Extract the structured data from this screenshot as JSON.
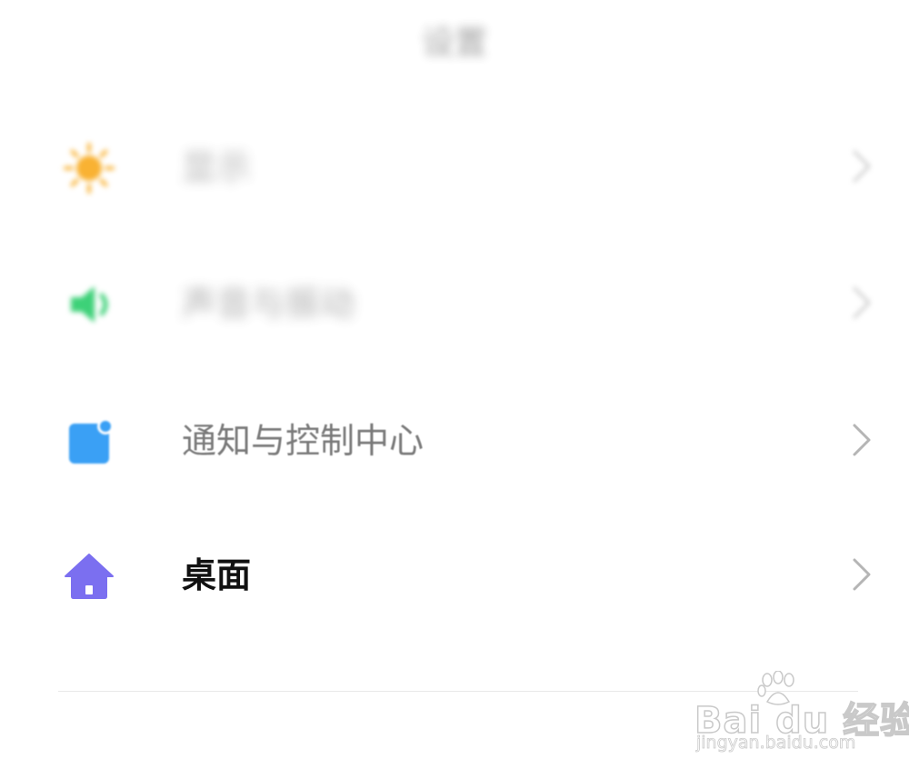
{
  "header": {
    "title": "设置"
  },
  "settings": {
    "items": [
      {
        "label": "显示",
        "icon": "brightness-sun-icon",
        "icon_color": "#F9B233",
        "blurred": true
      },
      {
        "label": "声音与振动",
        "icon": "speaker-volume-icon",
        "icon_color": "#3DD178",
        "blurred": true
      },
      {
        "label": "通知与控制中心",
        "icon": "notification-square-icon",
        "icon_color": "#3AA0F5",
        "blurred": false
      },
      {
        "label": "桌面",
        "icon": "home-icon",
        "icon_color": "#7B6FF0",
        "blurred": false
      }
    ]
  },
  "watermark": {
    "logo_text": "Bai du 经验",
    "url": "jingyan.baidu.com"
  },
  "colors": {
    "background": "#FFFFFF",
    "chevron": "#B5B5B5",
    "divider": "#E8E8E8"
  }
}
